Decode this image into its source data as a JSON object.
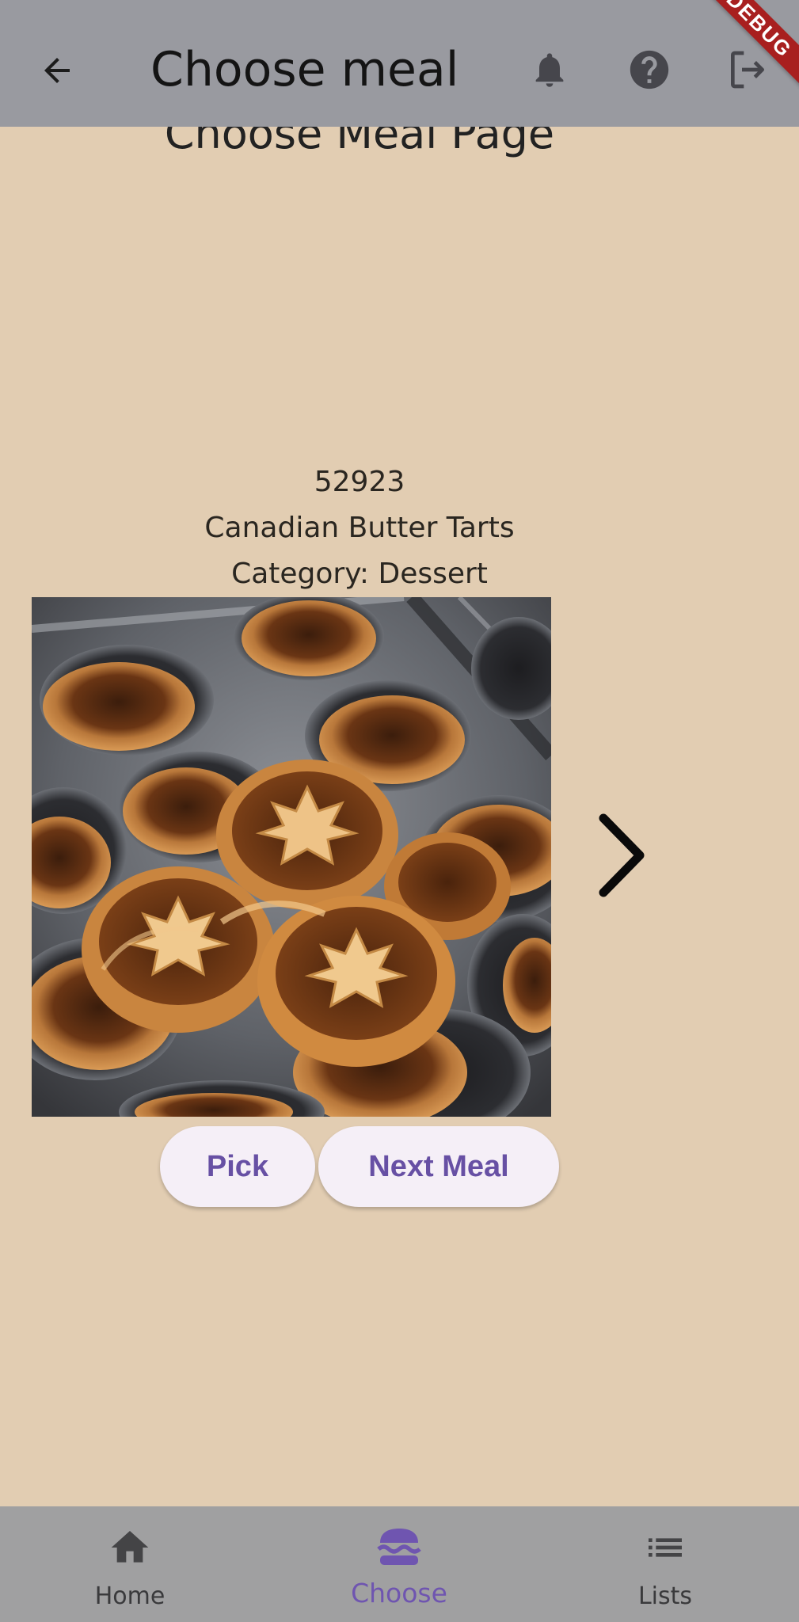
{
  "appbar": {
    "title": "Choose meal",
    "back_icon": "arrow-left-icon",
    "actions": [
      "bell-icon",
      "help-circle-icon",
      "logout-icon"
    ],
    "background": "#999aa0"
  },
  "debug_banner": "DEBUG",
  "page": {
    "heading": "Choose Meal Page",
    "background": "#e2cdb2"
  },
  "meal": {
    "id": "52923",
    "name": "Canadian Butter Tarts",
    "category": "Category: Dessert"
  },
  "next_arrow_icon": "chevron-right-icon",
  "buttons": {
    "pick": "Pick",
    "next_meal": "Next Meal"
  },
  "bottom_nav": {
    "items": [
      {
        "label": "Home",
        "icon": "home-icon",
        "selected": false
      },
      {
        "label": "Choose",
        "icon": "burger-icon",
        "selected": true
      },
      {
        "label": "Lists",
        "icon": "list-icon",
        "selected": false
      }
    ],
    "accent": "#6f55b0"
  }
}
